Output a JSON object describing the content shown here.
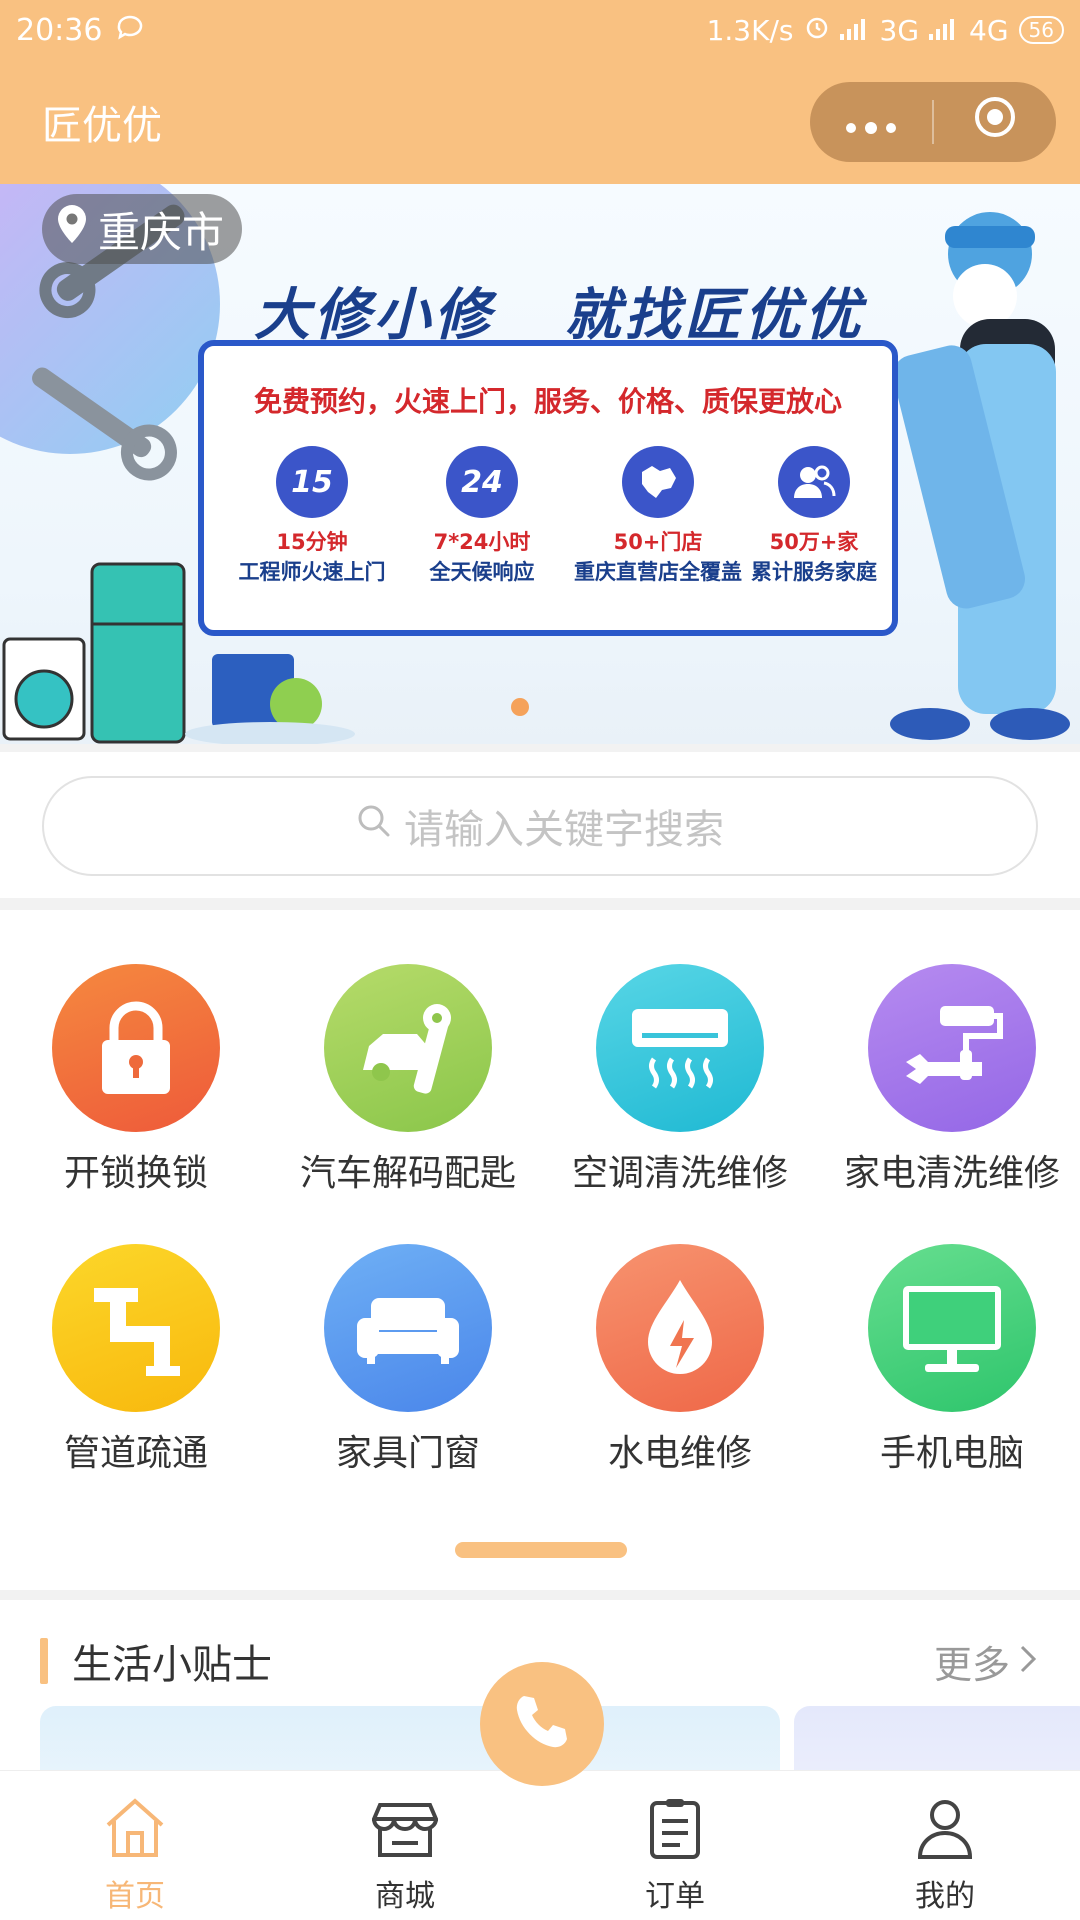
{
  "status_bar": {
    "time": "20:36",
    "net_speed": "1.3K/s",
    "net1": "3G",
    "net2": "4G",
    "battery": "56"
  },
  "title_bar": {
    "app_title": "匠优优"
  },
  "banner": {
    "location": "重庆市",
    "headline": "大修小修   就找匠优优",
    "slogan": "免费预约，火速上门，服务、价格、质保更放心",
    "features": [
      {
        "badge": "15",
        "line1": "15分钟",
        "line2": "工程师火速上门"
      },
      {
        "badge": "24",
        "line1": "7*24小时",
        "line2": "全天候响应"
      },
      {
        "badge": "",
        "line1": "50+门店",
        "line2": "重庆直营店全覆盖"
      },
      {
        "badge": "",
        "line1": "50万+家",
        "line2": "累计服务家庭"
      }
    ]
  },
  "search": {
    "placeholder": "请输入关键字搜索"
  },
  "services": [
    {
      "label": "开锁换锁",
      "icon": "lock-icon",
      "color": "#f06a3a"
    },
    {
      "label": "汽车解码配匙",
      "icon": "car-key-icon",
      "color": "#9fcf56"
    },
    {
      "label": "空调清洗维修",
      "icon": "air-conditioner-icon",
      "color": "#2ec9d8"
    },
    {
      "label": "家电清洗维修",
      "icon": "paint-roller-wrench-icon",
      "color": "#a777ea"
    },
    {
      "label": "管道疏通",
      "icon": "pipe-icon",
      "color": "#fbc817"
    },
    {
      "label": "家具门窗",
      "icon": "sofa-icon",
      "color": "#5a9af0"
    },
    {
      "label": "水电维修",
      "icon": "water-electric-icon",
      "color": "#f4795c"
    },
    {
      "label": "手机电脑",
      "icon": "monitor-icon",
      "color": "#46d37e"
    }
  ],
  "tips": {
    "title": "生活小贴士",
    "more": "更多"
  },
  "tabbar": [
    {
      "label": "首页",
      "icon": "home-icon",
      "active": true
    },
    {
      "label": "商城",
      "icon": "store-icon",
      "active": false
    },
    {
      "label": "订单",
      "icon": "order-icon",
      "active": false
    },
    {
      "label": "我的",
      "icon": "user-icon",
      "active": false
    }
  ],
  "colors": {
    "primary": "#f9c181",
    "active_tab": "#f7b777"
  }
}
